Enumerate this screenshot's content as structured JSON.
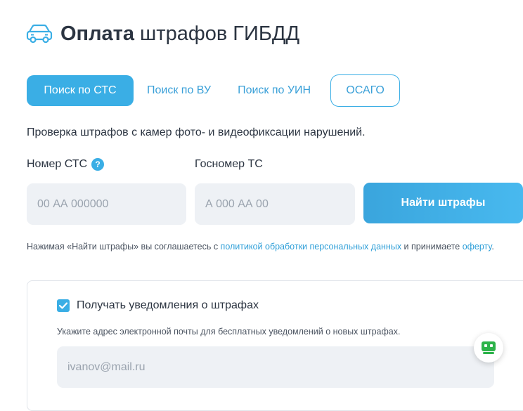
{
  "header": {
    "icon": "car-icon",
    "title_bold": "Оплата",
    "title_rest": "штрафов ГИБДД"
  },
  "tabs": [
    {
      "label": "Поиск по СТС",
      "active": true
    },
    {
      "label": "Поиск по ВУ",
      "active": false
    },
    {
      "label": "Поиск по УИН",
      "active": false
    },
    {
      "label": "ОСАГО",
      "active": false
    }
  ],
  "description": "Проверка штрафов с камер фото- и видеофиксации нарушений.",
  "form": {
    "sts_label": "Номер СТС",
    "sts_help": "?",
    "sts_placeholder": "00 АА 000000",
    "plate_label": "Госномер ТС",
    "plate_placeholder": "А 000 АА 00",
    "submit_label": "Найти штрафы"
  },
  "consent": {
    "text_before": "Нажимая «Найти штрафы» вы соглашаетесь с ",
    "privacy_link": "политикой обработки персональных данных",
    "text_middle": " и принимаете ",
    "offer_link": "оферту",
    "text_after": "."
  },
  "notifications": {
    "checked": true,
    "checkbox_label": "Получать уведомления о штрафах",
    "email_hint": "Укажите адрес электронной почты для бесплатных уведомлений о новых штрафах.",
    "email_placeholder": "ivanov@mail.ru"
  },
  "colors": {
    "accent": "#3aaee5",
    "link": "#2f9fd8",
    "input_bg": "#eef1f5",
    "text": "#2b3441",
    "widget_green": "#2db34a"
  }
}
